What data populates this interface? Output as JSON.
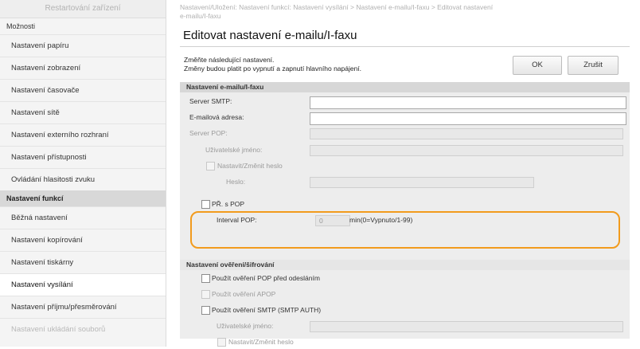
{
  "sidebar": {
    "restart_button": "Restartování zařízení",
    "section_options": "Možnosti",
    "options_items": [
      "Nastavení papíru",
      "Nastavení zobrazení",
      "Nastavení časovače",
      "Nastavení sítě",
      "Nastavení externího rozhraní",
      "Nastavení přístupnosti",
      "Ovládání hlasitosti zvuku"
    ],
    "section_functions": "Nastavení funkcí",
    "function_items": [
      "Běžná nastavení",
      "Nastavení kopírování",
      "Nastavení tiskárny",
      "Nastavení vysílání",
      "Nastavení příjmu/přesměrování",
      "Nastavení ukládání souborů"
    ]
  },
  "main": {
    "breadcrumb_line1": "Nastavení/Uložení: Nastavení funkcí: Nastavení vysílání > Nastavení e-mailu/I-faxu > Editovat nastavení",
    "breadcrumb_line2": "e-mailu/I-faxu",
    "title": "Editovat nastavení e-mailu/I-faxu",
    "message_line1": "Změňte následující nastavení.",
    "message_line2": "Změny budou platit po vypnutí a zapnutí hlavního napájení.",
    "ok_label": "OK",
    "cancel_label": "Zrušit"
  },
  "email_section": {
    "header": "Nastavení e-mailu/I-faxu",
    "smtp_server_label": "Server SMTP:",
    "smtp_server_value": "",
    "email_address_label": "E-mailová adresa:",
    "email_address_value": "",
    "pop_server_label": "Server POP:",
    "username_label": "Uživatelské jméno:",
    "set_change_password_label": "Nastavit/Změnit heslo",
    "password_label": "Heslo:",
    "pop_receive_label": "PŘ. s POP",
    "pop_interval_label": "Interval POP:",
    "pop_interval_value": "0",
    "pop_interval_unit": "min(0=Vypnuto/1-99)"
  },
  "auth_section": {
    "header": "Nastavení ověření/šifrování",
    "pop_before_send_label": "Použít ověření POP před odesláním",
    "apop_label": "Použít ověření APOP",
    "smtp_auth_label": "Použít ověření SMTP (SMTP AUTH)",
    "smtp_username_label": "Uživatelské jméno:",
    "smtp_set_password_label": "Nastavit/Změnit heslo"
  },
  "colors": {
    "highlight": "#f29b1d",
    "section_header": "#d7d7d7",
    "form_bg": "#ededed"
  }
}
